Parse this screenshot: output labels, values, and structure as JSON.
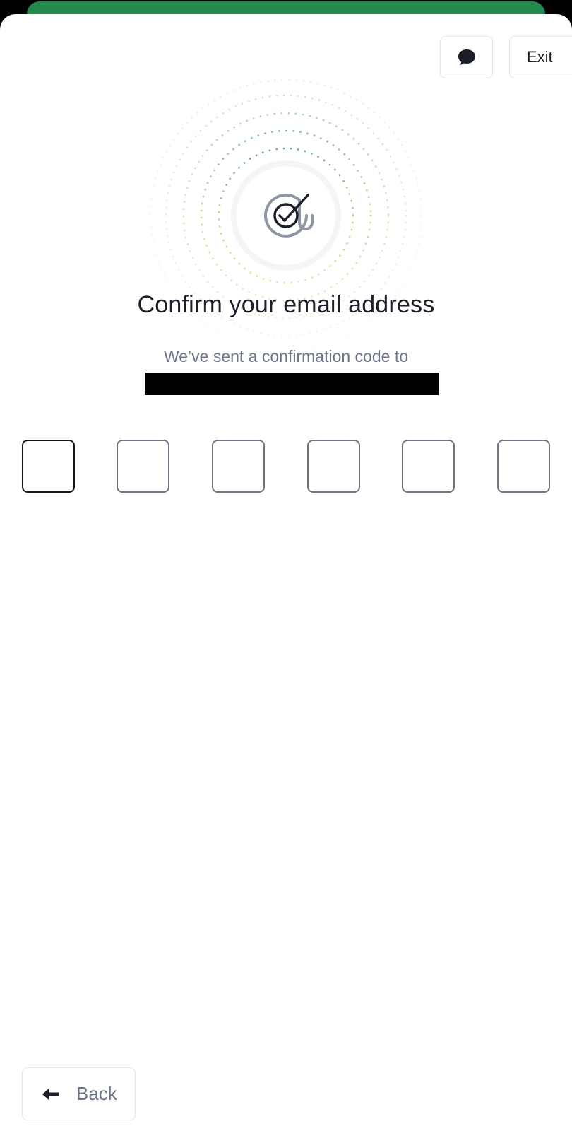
{
  "header": {
    "chat_icon": "speech-bubble-icon",
    "exit_label": "Exit"
  },
  "hero": {
    "icon": "email-check-icon",
    "ring_colors": [
      "#3fae7d",
      "#e6c25a"
    ]
  },
  "content": {
    "title": "Confirm your email address",
    "subtitle": "We’ve sent a confirmation code to",
    "email": ""
  },
  "code_input": {
    "digits": [
      "",
      "",
      "",
      "",
      "",
      ""
    ],
    "active_index": 0
  },
  "footer": {
    "back_icon": "arrow-left-icon",
    "back_label": "Back"
  },
  "colors": {
    "accent": "#238a4e",
    "text": "#1c1f2a",
    "muted": "#6b7488"
  }
}
